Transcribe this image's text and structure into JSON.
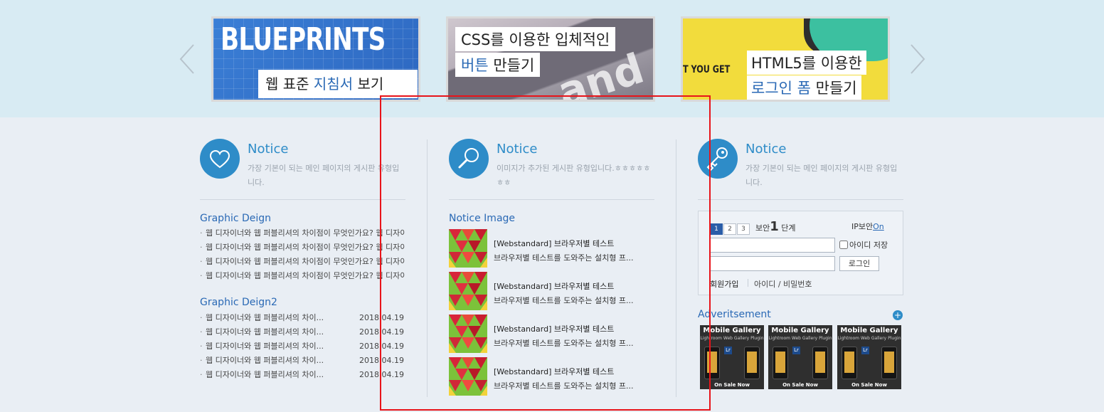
{
  "slider": {
    "slides": [
      {
        "title": "BLUEPRINTS",
        "caption_plain": "웹 표준 ",
        "caption_accent": "지침서",
        "caption_end": " 보기"
      },
      {
        "line1": "CSS를 이용한 입체적인",
        "line2_accent": "버튼",
        "line2_end": " 만들기",
        "bg_text": "and inte"
      },
      {
        "line1": "HTML5를 이용한",
        "line2_accent": "로그인 폼",
        "line2_end": " 만들기",
        "bg_text": "T YOU GET"
      }
    ]
  },
  "col1": {
    "title": "Notice",
    "desc": "가장 기본이 되는 메인 페이지의 게시판 유형입니다.",
    "section1_title": "Graphic Deign",
    "section1_items": [
      "웹 디자이너와 웹 퍼블리셔의 차이점이 무엇인가요? 웹 디자이너와 웹 퍼블리셔의 차이점",
      "웹 디자이너와 웹 퍼블리셔의 차이점이 무엇인가요? 웹 디자이너와 웹 퍼블리셔의 차이점",
      "웹 디자이너와 웹 퍼블리셔의 차이점이 무엇인가요? 웹 디자이너와 웹 퍼블리셔의 차이점",
      "웹 디자이너와 웹 퍼블리셔의 차이점이 무엇인가요? 웹 디자이너와 웹 퍼블리셔의 차이점"
    ],
    "section2_title": "Graphic Deign2",
    "section2_items": [
      {
        "text": "웹 디자이너와 웹 퍼블리셔의 차이...",
        "date": "2018.04.19"
      },
      {
        "text": "웹 디자이너와 웹 퍼블리셔의 차이...",
        "date": "2018.04.19"
      },
      {
        "text": "웹 디자이너와 웹 퍼블리셔의 차이...",
        "date": "2018.04.19"
      },
      {
        "text": "웹 디자이너와 웹 퍼블리셔의 차이...",
        "date": "2018.04.19"
      },
      {
        "text": "웹 디자이너와 웹 퍼블리셔의 차이...",
        "date": "2018.04.19"
      }
    ]
  },
  "col2": {
    "title": "Notice",
    "desc": "이미지가 추가된 게시판 유형입니다.ㅎㅎㅎㅎㅎㅎㅎ",
    "section_title": "Notice Image",
    "items": [
      {
        "title": "[Webstandard] 브라우저별 테스트",
        "desc": "브라우저별 테스트를 도와주는 설치형 프..."
      },
      {
        "title": "[Webstandard] 브라우저별 테스트",
        "desc": "브라우저별 테스트를 도와주는 설치형 프..."
      },
      {
        "title": "[Webstandard] 브라우저별 테스트",
        "desc": "브라우저별 테스트를 도와주는 설치형 프..."
      },
      {
        "title": "[Webstandard] 브라우저별 테스트",
        "desc": "브라우저별 테스트를 도와주는 설치형 프..."
      }
    ]
  },
  "col3": {
    "title": "Notice",
    "desc": "가장 기본이 되는 메인 페이지의 게시판 유형입니다.",
    "login": {
      "steps": [
        "1",
        "2",
        "3"
      ],
      "sec_prefix": "보안",
      "sec_level": "1",
      "sec_suffix": "단계",
      "ip_label": "IP보안",
      "ip_value": "On",
      "keep_label": "아이디 저장",
      "login_button": "로그인",
      "join_link": "회원가입",
      "find_link": "아이디 / 비밀번호"
    },
    "adv_title": "Adveritsement",
    "ads": [
      {
        "title": "Mobile Gallery",
        "subtitle": "Lightroom Web Gallery Plugin",
        "sale": "On Sale Now"
      },
      {
        "title": "Mobile Gallery",
        "subtitle": "Lightroom Web Gallery Plugin",
        "sale": "On Sale Now"
      },
      {
        "title": "Mobile Gallery",
        "subtitle": "Lightroom Web Gallery Plugin",
        "sale": "On Sale Now"
      }
    ]
  },
  "colors": {
    "accent": "#2e8cc8",
    "link": "#2a69b5",
    "highlight_box": "#e8141a",
    "band": "#d8ebf3"
  }
}
